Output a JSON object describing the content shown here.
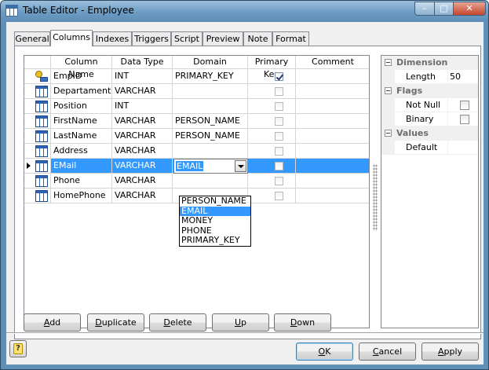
{
  "window": {
    "title": "Table Editor - Employee",
    "min_label": "–",
    "max_label": "□",
    "close_label": "✕"
  },
  "tabs": [
    "General",
    "Columns",
    "Indexes",
    "Triggers",
    "Script",
    "Preview",
    "Note",
    "Format"
  ],
  "active_tab": "Columns",
  "grid": {
    "headers": [
      "Column Name",
      "Data Type",
      "Domain",
      "Primary Key",
      "Comment"
    ],
    "rows": [
      {
        "name": "EmpID",
        "type": "INT",
        "domain": "PRIMARY_KEY",
        "pk": true,
        "comment": "",
        "icon": "key-icon"
      },
      {
        "name": "Departament",
        "type": "VARCHAR",
        "domain": "",
        "pk": false,
        "comment": "",
        "icon": "column-icon"
      },
      {
        "name": "Position",
        "type": "INT",
        "domain": "",
        "pk": false,
        "comment": "",
        "icon": "column-icon"
      },
      {
        "name": "FirstName",
        "type": "VARCHAR",
        "domain": "PERSON_NAME",
        "pk": false,
        "comment": "",
        "icon": "column-icon"
      },
      {
        "name": "LastName",
        "type": "VARCHAR",
        "domain": "PERSON_NAME",
        "pk": false,
        "comment": "",
        "icon": "column-icon"
      },
      {
        "name": "Address",
        "type": "VARCHAR",
        "domain": "",
        "pk": false,
        "comment": "",
        "icon": "column-icon"
      },
      {
        "name": "EMail",
        "type": "VARCHAR",
        "domain": "EMAIL",
        "pk": false,
        "comment": "",
        "icon": "column-icon"
      },
      {
        "name": "Phone",
        "type": "VARCHAR",
        "domain": "",
        "pk": false,
        "comment": "",
        "icon": "column-icon"
      },
      {
        "name": "HomePhone",
        "type": "VARCHAR",
        "domain": "",
        "pk": false,
        "comment": "",
        "icon": "column-icon"
      }
    ],
    "selected_row": 6,
    "domain_dropdown": {
      "value": "EMAIL",
      "options": [
        "PERSON_NAME",
        "EMAIL",
        "MONEY",
        "PHONE",
        "PRIMARY_KEY"
      ],
      "highlighted": "EMAIL"
    }
  },
  "properties": {
    "dimension": {
      "label": "Dimension",
      "length_label": "Length",
      "length_value": "50"
    },
    "flags": {
      "label": "Flags",
      "not_null_label": "Not Null",
      "binary_label": "Binary"
    },
    "values": {
      "label": "Values",
      "default_label": "Default",
      "default_value": ""
    }
  },
  "buttons": {
    "add": {
      "u": "A",
      "rest": "dd"
    },
    "duplicate": {
      "u": "D",
      "rest": "uplicate"
    },
    "delete": {
      "u": "D",
      "rest": "elete"
    },
    "up": {
      "u": "U",
      "rest": "p"
    },
    "down": {
      "u": "D",
      "rest": "own"
    },
    "ok": {
      "u": "O",
      "rest": "K"
    },
    "cancel": {
      "u": "C",
      "rest": "ancel"
    },
    "apply": {
      "u": "A",
      "rest": "pply"
    }
  },
  "help_label": "?",
  "colors": {
    "selection": "#3399ff",
    "grid_line": "#d5d5d5",
    "frame": "#5f8fb5"
  }
}
